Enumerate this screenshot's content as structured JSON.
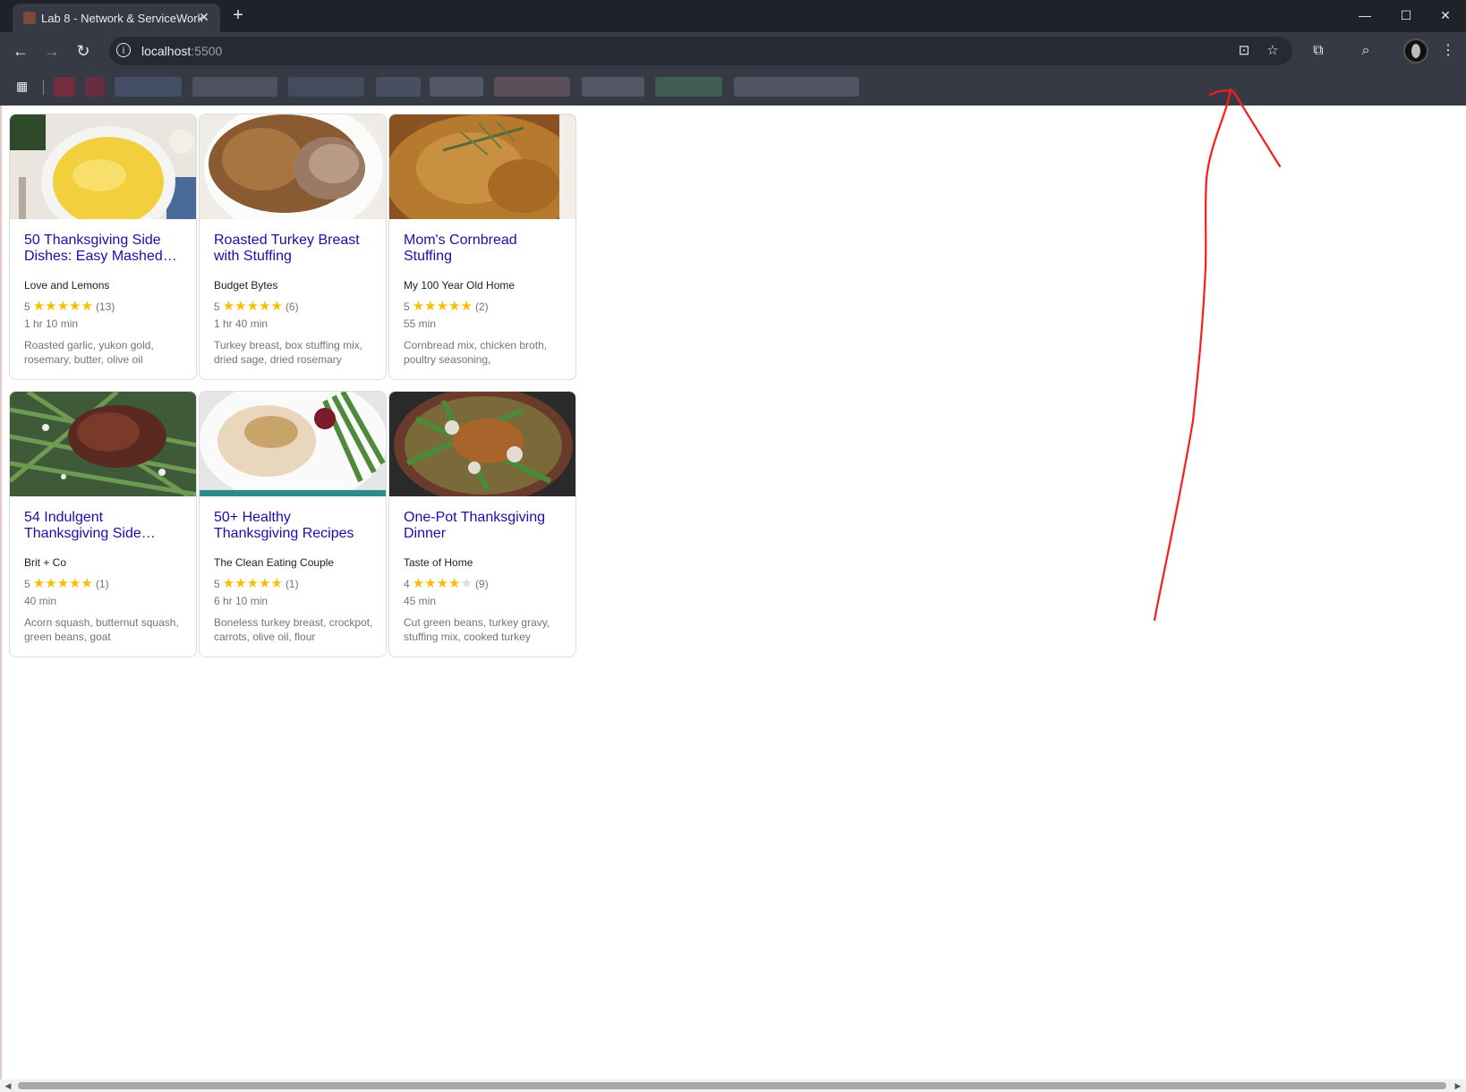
{
  "browser": {
    "tab_title": "Lab 8 - Network & ServiceWork",
    "tab_close": "✕",
    "new_tab": "+",
    "url_host": "localhost",
    "url_port": ":5500",
    "window_controls": [
      "—",
      "☐",
      "✕"
    ],
    "icons": [
      "back-icon",
      "forward-icon",
      "reload-icon",
      "site-info-icon",
      "install-app-icon",
      "bookmark-star-icon",
      "extensions-icon",
      "media-router-icon",
      "profile-avatar",
      "menu-icon",
      "apps-grid-icon"
    ]
  },
  "recipes": [
    {
      "title": "50 Thanksgiving Side Dishes: Easy Mashed…",
      "source": "Love and Lemons",
      "rating": "5",
      "stars": 5,
      "reviews": "(13)",
      "time": "1 hr 10 min",
      "ingredients": "Roasted garlic, yukon gold, rosemary, butter, olive oil"
    },
    {
      "title": "Roasted Turkey Breast with Stuffing",
      "source": "Budget Bytes",
      "rating": "5",
      "stars": 5,
      "reviews": "(6)",
      "time": "1 hr 40 min",
      "ingredients": "Turkey breast, box stuffing mix, dried sage, dried rosemary"
    },
    {
      "title": "Mom's Cornbread Stuffing",
      "source": "My 100 Year Old Home",
      "rating": "5",
      "stars": 5,
      "reviews": "(2)",
      "time": "55 min",
      "ingredients": "Cornbread mix, chicken broth, poultry seasoning,"
    },
    {
      "title": "54 Indulgent Thanksgiving Side…",
      "source": "Brit + Co",
      "rating": "5",
      "stars": 5,
      "reviews": "(1)",
      "time": "40 min",
      "ingredients": "Acorn squash, butternut squash, green beans, goat"
    },
    {
      "title": "50+ Healthy Thanksgiving Recipes",
      "source": "The Clean Eating Couple",
      "rating": "5",
      "stars": 5,
      "reviews": "(1)",
      "time": "6 hr 10 min",
      "ingredients": "Boneless turkey breast, crockpot, carrots, olive oil, flour"
    },
    {
      "title": "One-Pot Thanksgiving Dinner",
      "source": "Taste of Home",
      "rating": "4",
      "stars": 4,
      "reviews": "(9)",
      "time": "45 min",
      "ingredients": "Cut green beans, turkey gravy, stuffing mix, cooked turkey"
    }
  ],
  "colors": {
    "link": "#1a0dab",
    "star": "#fbbc04",
    "annotation": "#ff1a1a",
    "chrome_dark": "#1f2229",
    "chrome_toolbar": "#353a45"
  }
}
